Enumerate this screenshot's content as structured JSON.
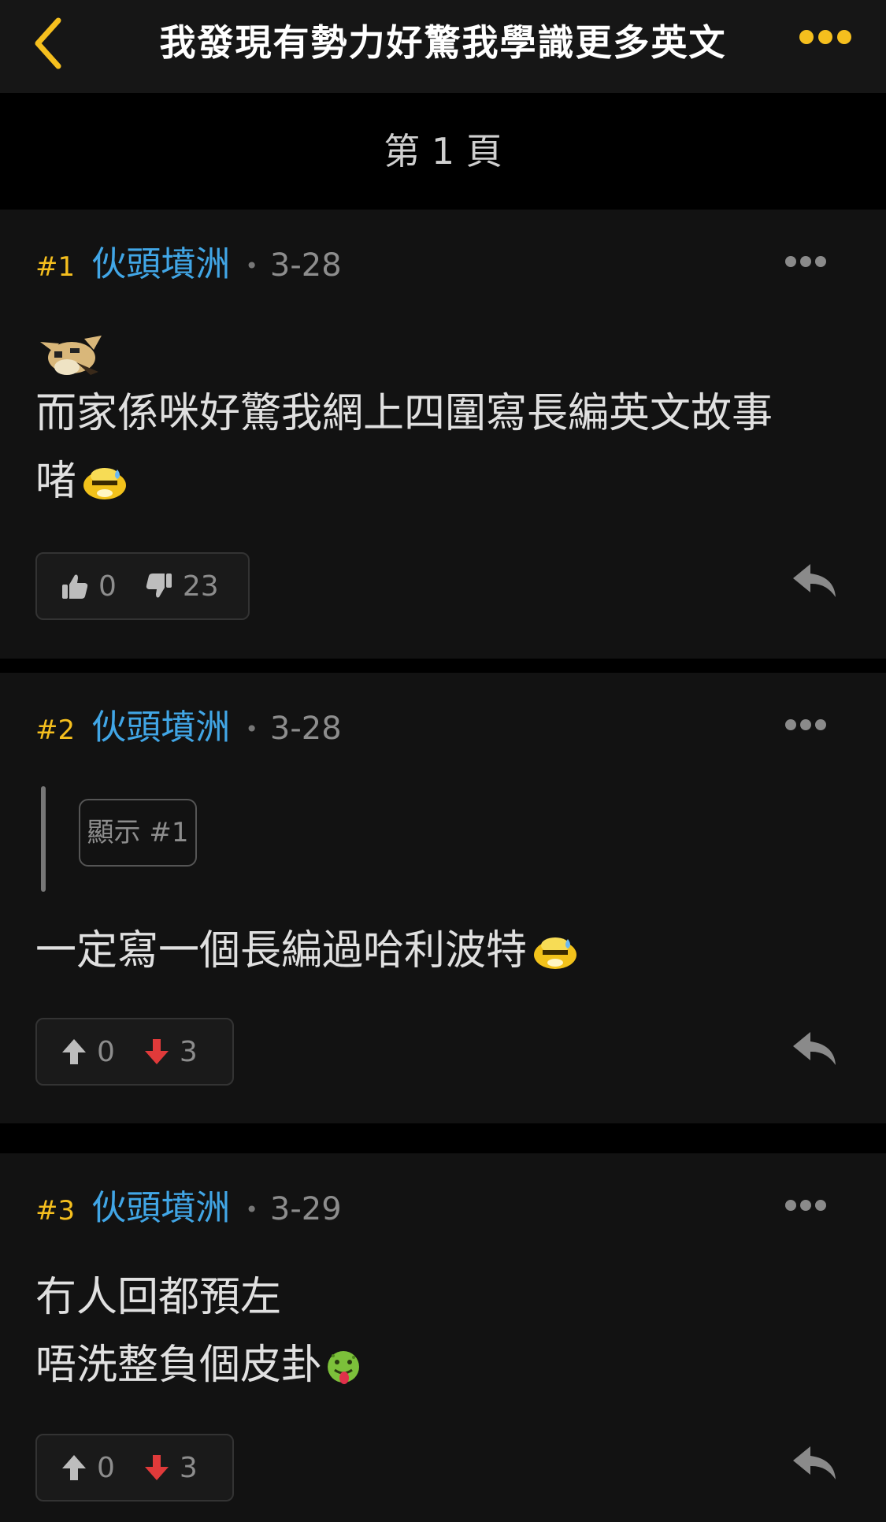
{
  "header": {
    "title": "我發現有勢力好驚我學識更多英文",
    "back_icon": "chevron-left-icon",
    "more_icon": "more-horizontal-icon",
    "accent": "#f5bf1e"
  },
  "page_label": "第 1 頁",
  "posts": [
    {
      "floor": "#1",
      "author": "伙頭墳洲",
      "separator": "•",
      "date": "3-28",
      "lines": [
        "而家係咪好驚我網上四圍寫長編英文故事",
        "啫"
      ],
      "emojis": [
        "fainting-dog-emoji",
        "sweat-face-emoji"
      ],
      "vote_style": "thumbs",
      "upvotes": "0",
      "downvotes": "23"
    },
    {
      "floor": "#2",
      "author": "伙頭墳洲",
      "separator": "•",
      "date": "3-28",
      "quote_label": "顯示 #1",
      "lines": [
        "一定寫一個長編過哈利波特"
      ],
      "emojis": [
        "sweat-face-emoji"
      ],
      "vote_style": "arrows",
      "upvotes": "0",
      "downvotes": "3"
    },
    {
      "floor": "#3",
      "author": "伙頭墳洲",
      "separator": "•",
      "date": "3-29",
      "lines": [
        "冇人回都預左",
        "唔洗整負個皮卦"
      ],
      "emojis": [
        "sick-face-emoji"
      ],
      "vote_style": "arrows",
      "upvotes": "0",
      "downvotes": "3"
    }
  ],
  "colors": {
    "author": "#41a6e6",
    "floor": "#f5bf1e",
    "downvote_arrow": "#e03a3a"
  }
}
